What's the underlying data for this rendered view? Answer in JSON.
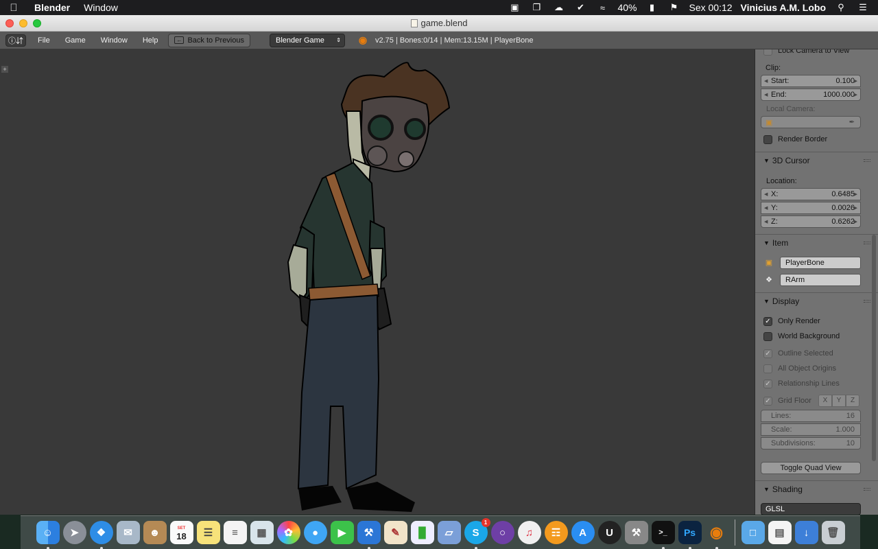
{
  "menubar": {
    "app_name": "Blender",
    "menu_window": "Window",
    "battery": "40%",
    "clock": "Sex 00:12",
    "user": "Vinicius A.M. Lobo"
  },
  "window": {
    "title": "game.blend"
  },
  "header": {
    "editor_icon": "info-icon",
    "menus": [
      "File",
      "Game",
      "Window",
      "Help"
    ],
    "back_button": "Back to Previous",
    "engine": "Blender Game",
    "stats": "v2.75 | Bones:0/14  | Mem:13.15M | PlayerBone"
  },
  "panel": {
    "lock_camera": "Lock Camera to View",
    "clip_label": "Clip:",
    "clip_start_label": "Start:",
    "clip_start": "0.100",
    "clip_end_label": "End:",
    "clip_end": "1000.000",
    "local_camera_label": "Local Camera:",
    "render_border": "Render Border",
    "cursor_section": "3D Cursor",
    "location_label": "Location:",
    "x_label": "X:",
    "x_value": "0.6485",
    "y_label": "Y:",
    "y_value": "0.0026",
    "z_label": "Z:",
    "z_value": "0.6262",
    "item_section": "Item",
    "item_object": "PlayerBone",
    "item_bone": "RArm",
    "display_section": "Display",
    "only_render": "Only Render",
    "world_background": "World Background",
    "outline_selected": "Outline Selected",
    "all_object_origins": "All Object Origins",
    "relationship_lines": "Relationship Lines",
    "grid_floor": "Grid Floor",
    "axis_x": "X",
    "axis_y": "Y",
    "axis_z": "Z",
    "lines_label": "Lines:",
    "lines_value": "16",
    "scale_label": "Scale:",
    "scale_value": "1.000",
    "subdiv_label": "Subdivisions:",
    "subdiv_value": "10",
    "toggle_quad": "Toggle Quad View",
    "shading_section": "Shading",
    "shading_mode": "GLSL"
  },
  "dock": {
    "calendar_month": "SET",
    "calendar_day": "18",
    "skype_badge": "1",
    "photoshop": "Ps"
  }
}
